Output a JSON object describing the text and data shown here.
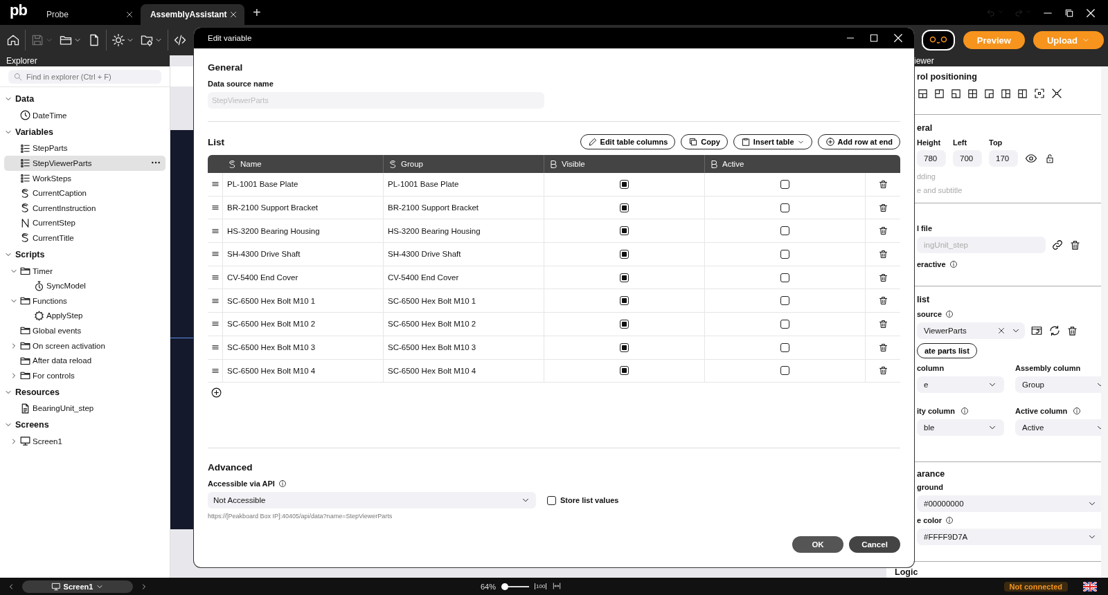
{
  "title_bar": {
    "logo": "pb",
    "tabs": [
      {
        "label": "Probe",
        "selected": false
      },
      {
        "label": "AssemblyAssistant",
        "selected": true
      }
    ],
    "new_tab": "+",
    "history": [
      {
        "kind": "undo",
        "disabled": true
      },
      {
        "kind": "redo",
        "disabled": true
      }
    ]
  },
  "toolbar": {
    "tools": [
      {
        "kind": "home",
        "disabled": false,
        "menu": false
      },
      {
        "kind": "save",
        "disabled": true,
        "menu": true
      },
      {
        "kind": "open",
        "disabled": false,
        "menu": true
      },
      {
        "kind": "new",
        "disabled": false,
        "menu": false
      },
      {
        "kind": "settings",
        "disabled": false,
        "menu": true
      },
      {
        "kind": "project-settings",
        "disabled": false,
        "menu": true
      },
      {
        "kind": "code",
        "disabled": false,
        "menu": false
      }
    ],
    "preview": "Preview",
    "upload": "Upload"
  },
  "explorer": {
    "title": "Explorer",
    "search": {
      "placeholder": "Find in explorer (Ctrl + F)"
    },
    "sections": [
      {
        "label": "Data",
        "expanded": true,
        "children": [
          {
            "label": "DateTime",
            "kind": "clock",
            "selected": false
          }
        ]
      },
      {
        "label": "Variables",
        "expanded": true,
        "children": [
          {
            "label": "StepParts",
            "kind": "list",
            "selected": false
          },
          {
            "label": "StepViewerParts",
            "kind": "list",
            "selected": true
          },
          {
            "label": "WorkSteps",
            "kind": "list",
            "selected": false
          },
          {
            "label": "CurrentCaption",
            "kind": "string",
            "selected": false
          },
          {
            "label": "CurrentInstruction",
            "kind": "string",
            "selected": false
          },
          {
            "label": "CurrentStep",
            "kind": "number",
            "selected": false
          },
          {
            "label": "CurrentTitle",
            "kind": "string",
            "selected": false
          }
        ]
      },
      {
        "label": "Scripts",
        "expanded": true,
        "children": [
          {
            "label": "Timer",
            "kind": "folder",
            "expanded": true,
            "selected": false,
            "children": [
              {
                "label": "SyncModel",
                "kind": "timer",
                "selected": false
              }
            ]
          },
          {
            "label": "Functions",
            "kind": "folder",
            "expanded": true,
            "selected": false,
            "children": [
              {
                "label": "ApplyStep",
                "kind": "function",
                "selected": false
              }
            ]
          },
          {
            "label": "Global events",
            "kind": "folder",
            "selected": false
          },
          {
            "label": "On screen activation",
            "kind": "folder",
            "expanded": false,
            "selected": false
          },
          {
            "label": "After data reload",
            "kind": "folder",
            "selected": false
          },
          {
            "label": "For controls",
            "kind": "folder",
            "expanded": false,
            "selected": false
          }
        ]
      },
      {
        "label": "Resources",
        "expanded": true,
        "children": [
          {
            "label": "BearingUnit_step",
            "kind": "file",
            "selected": false
          }
        ]
      },
      {
        "label": "Screens",
        "expanded": true,
        "children": [
          {
            "label": "Screen1",
            "kind": "screen",
            "expanded": false,
            "selected": false
          }
        ]
      }
    ]
  },
  "properties": {
    "title": "iewer",
    "positioning": {
      "title": "rol positioning"
    },
    "general": {
      "title": "eral",
      "fields": [
        {
          "label": "Height",
          "value": "780"
        },
        {
          "label": "Left",
          "value": "700"
        },
        {
          "label": "Top",
          "value": "170"
        }
      ],
      "options": [
        "dding",
        "e and subtitle"
      ]
    },
    "model": {
      "label": "l file",
      "placeholder": "ingUnit_step",
      "interactive": "eractive"
    },
    "parts_list": {
      "title": "list",
      "source_label": "source",
      "source_value": "ViewerParts",
      "create_button": "ate parts list",
      "columns": [
        {
          "label": "column",
          "value": "e",
          "info": false
        },
        {
          "label": "Assembly column",
          "value": "Group",
          "info": false
        },
        {
          "label": "ity column",
          "value": "ble",
          "info": true
        },
        {
          "label": "Active column",
          "value": "Active",
          "info": true
        }
      ]
    },
    "appearance": {
      "title": "arance",
      "background_label": "ground",
      "background_value": "#00000000",
      "color_label": "e color",
      "color_value": "#FFFF9D7A"
    },
    "logic": "Logic"
  },
  "dialog": {
    "title": "Edit variable",
    "general": {
      "title": "General",
      "source_label": "Data source name",
      "source_value": "StepViewerParts"
    },
    "list": {
      "title": "List",
      "actions": [
        {
          "label": "Edit table columns",
          "kind": "edit"
        },
        {
          "label": "Copy",
          "kind": "copy"
        },
        {
          "label": "Insert table",
          "kind": "insert"
        },
        {
          "label": "Add row at end",
          "kind": "add"
        }
      ],
      "columns": [
        {
          "label": "Name",
          "kind": "string"
        },
        {
          "label": "Group",
          "kind": "string"
        },
        {
          "label": "Visible",
          "kind": "boolean"
        },
        {
          "label": "Active",
          "kind": "boolean"
        }
      ],
      "rows": [
        {
          "values": [
            "PL-1001 Base Plate",
            "PL-1001 Base Plate",
            true,
            false
          ]
        },
        {
          "values": [
            "BR-2100 Support Bracket",
            "BR-2100 Support Bracket",
            true,
            false
          ]
        },
        {
          "values": [
            "HS-3200 Bearing Housing",
            "HS-3200 Bearing Housing",
            true,
            false
          ]
        },
        {
          "values": [
            "SH-4300 Drive Shaft",
            "SH-4300 Drive Shaft",
            true,
            false
          ]
        },
        {
          "values": [
            "CV-5400 End Cover",
            "CV-5400 End Cover",
            true,
            false
          ]
        },
        {
          "values": [
            "SC-6500 Hex Bolt M10 1",
            "SC-6500 Hex Bolt M10 1",
            true,
            false
          ]
        },
        {
          "values": [
            "SC-6500 Hex Bolt M10 2",
            "SC-6500 Hex Bolt M10 2",
            true,
            false
          ]
        },
        {
          "values": [
            "SC-6500 Hex Bolt M10 3",
            "SC-6500 Hex Bolt M10 3",
            true,
            false
          ]
        },
        {
          "values": [
            "SC-6500 Hex Bolt M10 4",
            "SC-6500 Hex Bolt M10 4",
            true,
            false
          ]
        }
      ]
    },
    "advanced": {
      "title": "Advanced",
      "api_label": "Accessible via API",
      "api_value": "Not Accessible",
      "store_label": "Store list values",
      "store_checked": false,
      "url": "https://[Peakboard Box IP]:40405/api/data?name=StepViewerParts"
    },
    "buttons": [
      {
        "label": "OK",
        "kind": "ok"
      },
      {
        "label": "Cancel",
        "kind": "cancel"
      }
    ]
  },
  "status_bar": {
    "screen": "Screen1",
    "zoom": {
      "label": "64%",
      "level": 0.12,
      "reset": "100"
    },
    "connection": "Not connected"
  }
}
